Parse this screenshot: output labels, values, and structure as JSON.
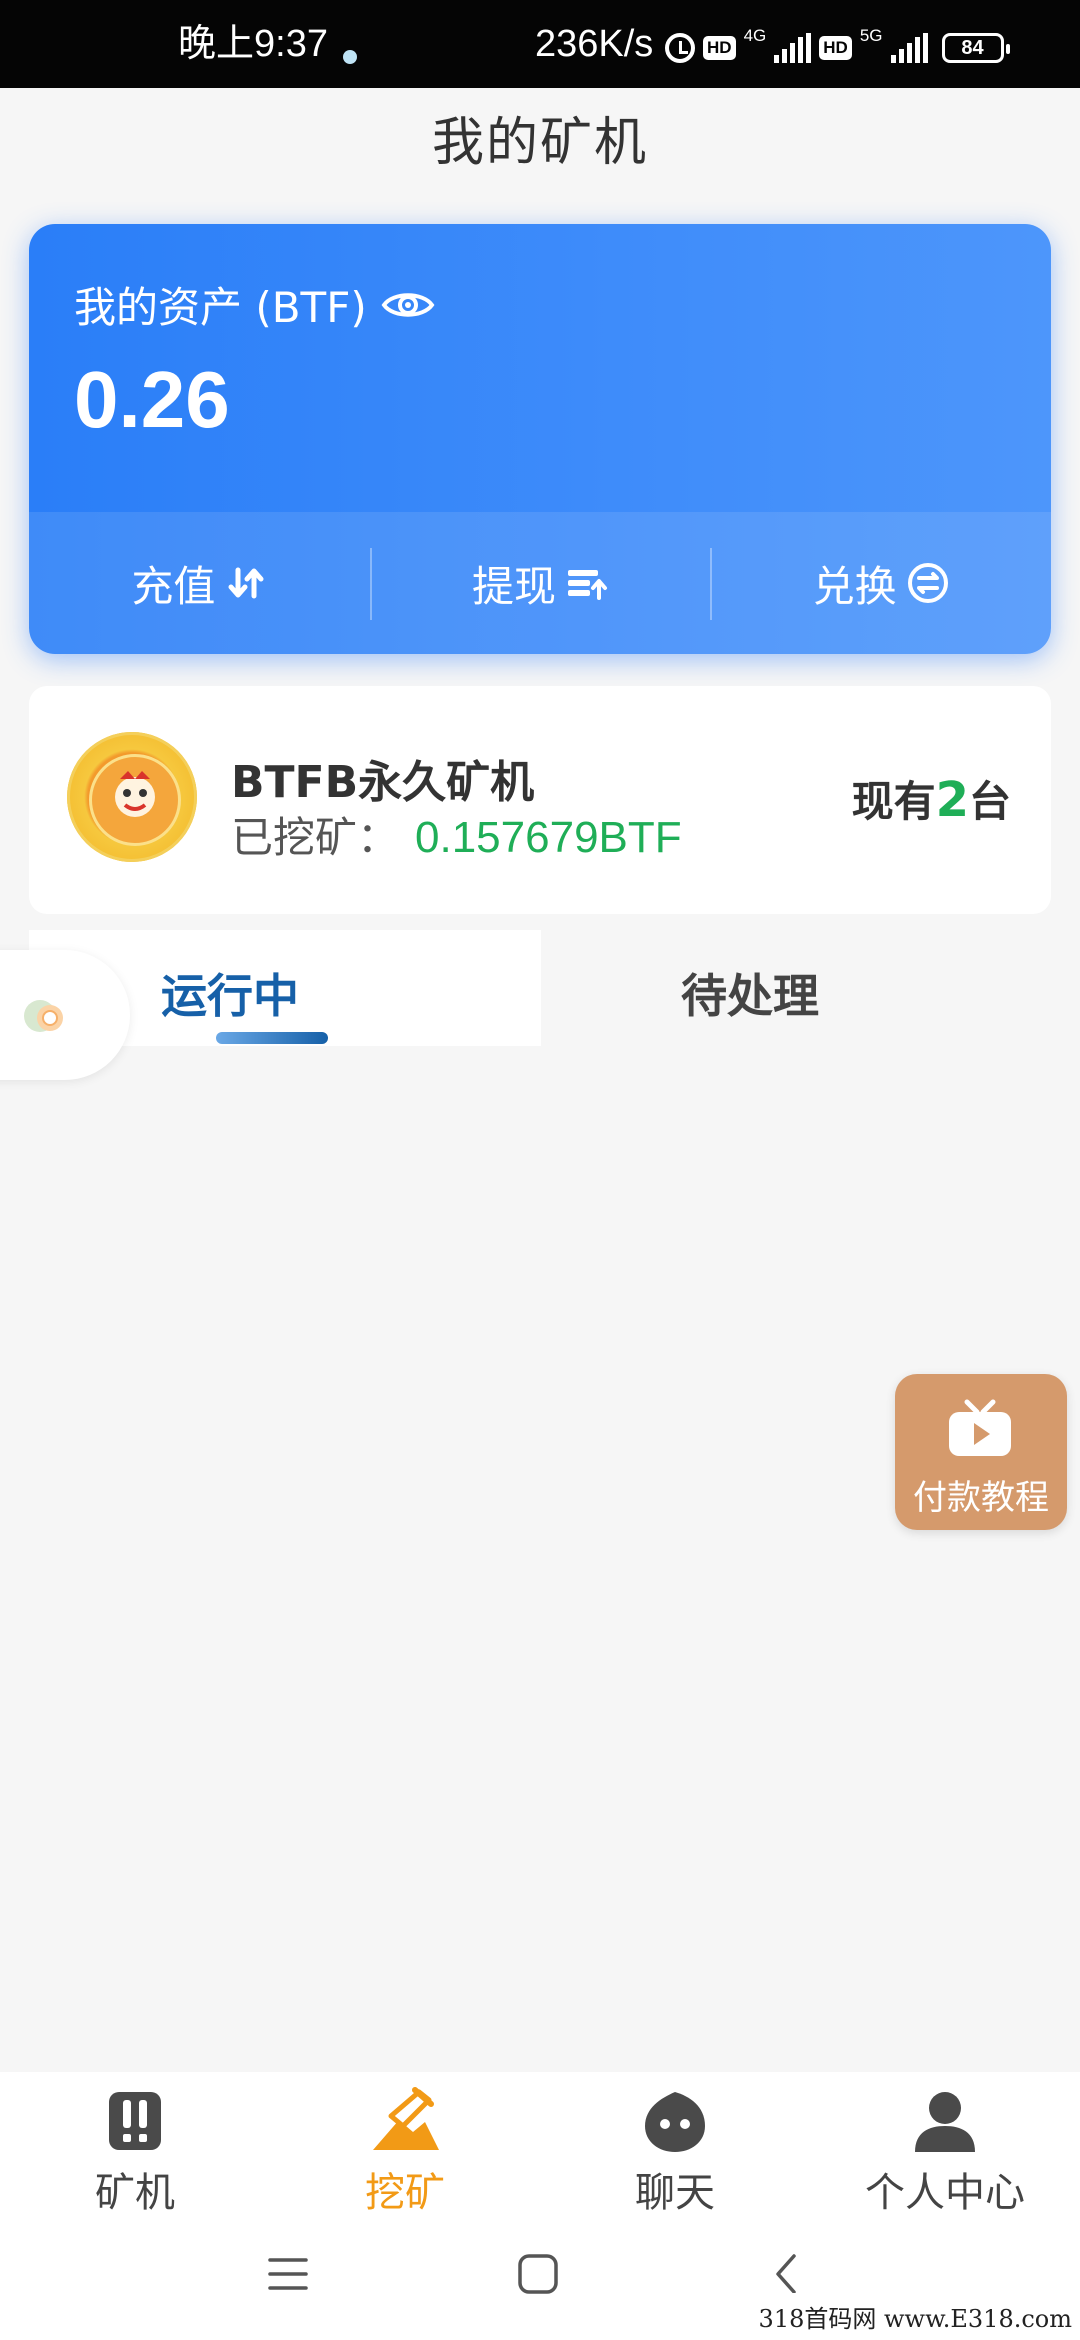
{
  "status_bar": {
    "time": "晚上9:37",
    "speed": "236K/s",
    "hd1": "HD",
    "net1": "4G",
    "hd2": "HD",
    "net2": "5G",
    "battery": "84"
  },
  "page_title": "我的矿机",
  "asset": {
    "label": "我的资产 (BTF)",
    "value": "0.26",
    "actions": [
      {
        "label": "充值",
        "icon": "transfer-arrows-icon"
      },
      {
        "label": "提现",
        "icon": "withdraw-icon"
      },
      {
        "label": "兑换",
        "icon": "exchange-icon"
      }
    ]
  },
  "miner": {
    "name": "BTFB永久矿机",
    "mined_label": "已挖矿：",
    "mined_value": "0.157679BTF",
    "count_prefix": "现有",
    "count": "2",
    "count_suffix": "台"
  },
  "tabs": [
    {
      "label": "运行中",
      "active": true
    },
    {
      "label": "待处理",
      "active": false
    }
  ],
  "pay_tutorial": {
    "label": "付款教程",
    "icon": "tv-play-icon"
  },
  "bottom_nav": [
    {
      "label": "矿机",
      "icon": "miner-icon",
      "active": false
    },
    {
      "label": "挖矿",
      "icon": "mining-icon",
      "active": true
    },
    {
      "label": "聊天",
      "icon": "chat-icon",
      "active": false
    },
    {
      "label": "个人中心",
      "icon": "profile-icon",
      "active": false
    }
  ],
  "colors": {
    "card_blue": "#2a7ef8",
    "green": "#1fae57",
    "active_orange": "#f29a16",
    "tab_blue": "#1660a8",
    "tutorial_tan": "#d59a6c"
  },
  "watermark": "318首码网  www.E318.com"
}
